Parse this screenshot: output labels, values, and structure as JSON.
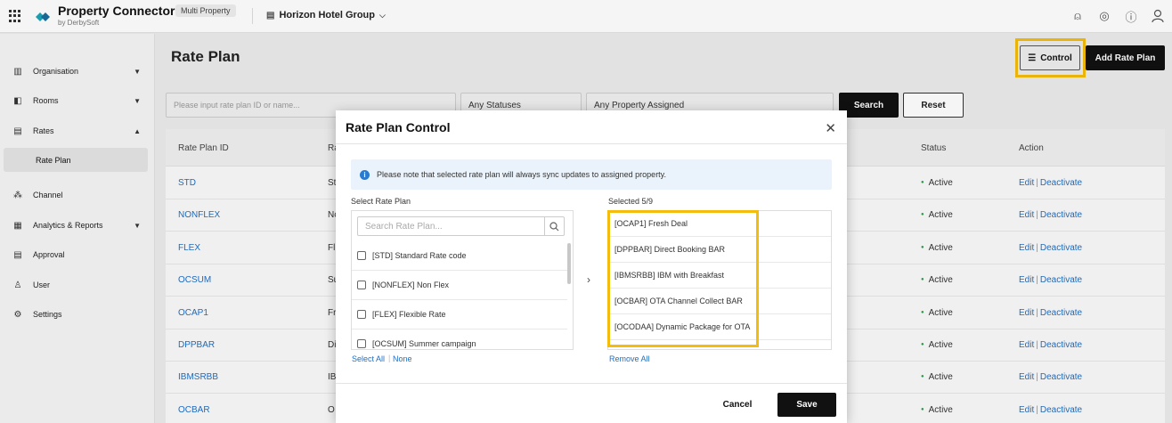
{
  "header": {
    "brand_title": "Property Connector",
    "brand_sub": "by DerbySoft",
    "badge": "Multi Property",
    "group": "Horizon Hotel Group"
  },
  "sidebar": {
    "items": [
      {
        "label": "Organisation",
        "icon": "organisation-icon"
      },
      {
        "label": "Rooms",
        "icon": "rooms-icon"
      },
      {
        "label": "Rates",
        "icon": "rates-icon"
      },
      {
        "label": "Rate Plan"
      },
      {
        "label": "Channel",
        "icon": "channel-icon"
      },
      {
        "label": "Analytics & Reports",
        "icon": "analytics-icon"
      },
      {
        "label": "Approval",
        "icon": "approval-icon"
      },
      {
        "label": "User",
        "icon": "user-icon"
      },
      {
        "label": "Settings",
        "icon": "settings-icon"
      }
    ]
  },
  "main": {
    "title": "Rate Plan",
    "control_label": "Control",
    "add_label": "Add Rate Plan",
    "filter_placeholder": "Please input rate plan ID or name...",
    "status_select": "Any Statuses",
    "property_select": "Any Property Assigned",
    "search_label": "Search",
    "reset_label": "Reset"
  },
  "table": {
    "headers": [
      "Rate Plan ID",
      "Ra",
      "Status",
      "Action"
    ],
    "rows": [
      {
        "id": "STD",
        "name": "St",
        "status": "Active"
      },
      {
        "id": "NONFLEX",
        "name": "Nc",
        "status": "Active"
      },
      {
        "id": "FLEX",
        "name": "Fl",
        "status": "Active"
      },
      {
        "id": "OCSUM",
        "name": "Su",
        "status": "Active"
      },
      {
        "id": "OCAP1",
        "name": "Fr",
        "status": "Active"
      },
      {
        "id": "DPPBAR",
        "name": "Di",
        "status": "Active"
      },
      {
        "id": "IBMSRBB",
        "name": "IB",
        "status": "Active"
      },
      {
        "id": "OCBAR",
        "name": "O",
        "status": "Active"
      }
    ],
    "edit_label": "Edit",
    "deactivate_label": "Deactivate"
  },
  "modal": {
    "title": "Rate Plan Control",
    "notice": "Please note that selected rate plan will always sync updates to assigned property.",
    "select_label": "Select Rate Plan",
    "search_placeholder": "Search Rate Plan...",
    "available": [
      "[STD] Standard Rate code",
      "[NONFLEX] Non Flex",
      "[FLEX] Flexible Rate",
      "[OCSUM] Summer campaign"
    ],
    "selected_label": "Selected 5/9",
    "selected": [
      "[OCAP1] Fresh Deal",
      "[DPPBAR] Direct Booking BAR",
      "[IBMSRBB] IBM with Breakfast",
      "[OCBAR] OTA Channel Collect BAR",
      "[OCODAA] Dynamic Package for OTA"
    ],
    "select_all": "Select All",
    "none": "None",
    "remove_all": "Remove All",
    "cancel": "Cancel",
    "save": "Save"
  },
  "colors": {
    "highlight": "#f4bc0c",
    "link": "#1f6fc5",
    "primary": "#111111",
    "active": "#2a9d4a"
  }
}
